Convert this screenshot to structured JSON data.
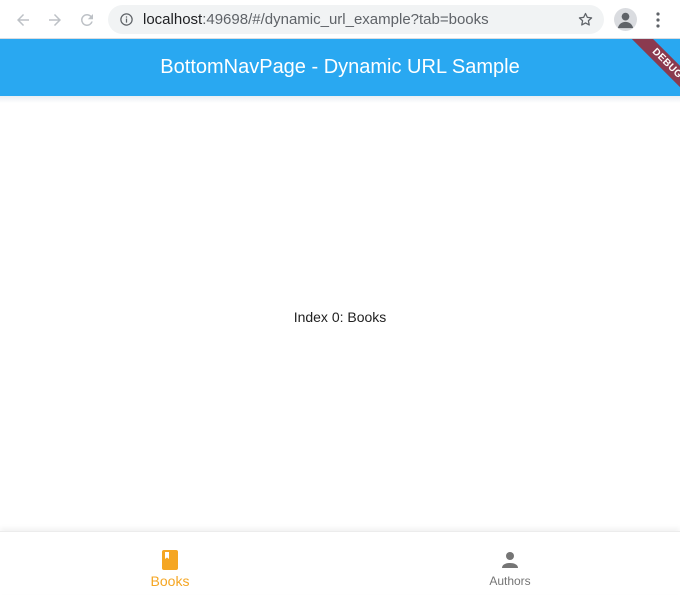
{
  "browser": {
    "url_host": "localhost",
    "url_rest": ":49698/#/dynamic_url_example?tab=books"
  },
  "app_bar": {
    "title": "BottomNavPage - Dynamic URL Sample",
    "debug_banner": "DEBUG",
    "color": "#29a8f1"
  },
  "body": {
    "text": "Index 0: Books"
  },
  "bottom_nav": {
    "items": [
      {
        "label": "Books",
        "icon": "book-icon",
        "active": true,
        "color": "#f5a623"
      },
      {
        "label": "Authors",
        "icon": "person-icon",
        "active": false,
        "color": "#757575"
      }
    ]
  }
}
